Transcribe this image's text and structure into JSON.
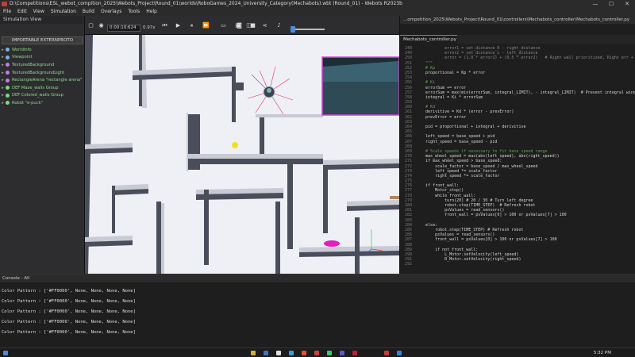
{
  "window": {
    "title": "D:\\Competitions\\ESL_webot_compition_2025\\Webots_Project\\Round_01\\worlds\\RoboGames_2024_University_Category(Mechabots).wbt (Round_01) - Webots R2023b",
    "controls": [
      "—",
      "☐",
      "✕"
    ]
  },
  "menu": [
    "File",
    "Edit",
    "View",
    "Simulation",
    "Build",
    "Overlays",
    "Tools",
    "Help"
  ],
  "scene_tree": {
    "title": "Simulation View",
    "import_button": "IMPORTABLE EXTERNPROTO",
    "items": [
      {
        "label": "WorldInfo",
        "color": "#7fb0e0"
      },
      {
        "label": "Viewpoint",
        "color": "#7fb0e0"
      },
      {
        "label": "TexturedBackground",
        "color": "#c080e0"
      },
      {
        "label": "TexturedBackgroundLight",
        "color": "#c080e0"
      },
      {
        "label": "RectangleArena \"rectangle arena\"",
        "color": "#c080e0"
      },
      {
        "label": "DEF Maze_walls Group",
        "color": "#7fd97f"
      },
      {
        "label": "DEF Colored_walls Group",
        "color": "#7fd97f"
      },
      {
        "label": "Robot \"e-puck\"",
        "color": "#7fd97f"
      }
    ]
  },
  "toolbar": {
    "time": "0:00:10:624",
    "speed": "0.97x"
  },
  "editor": {
    "path": "...ompetition_2025\\Webots_Project\\Round_01\\controllers\\Mechabots_controller\\Mechabots_controller.py",
    "tab": "Mechabots_controller.py",
    "lines": [
      {
        "n": "248",
        "t": "            error1 = set_distance_R - right_distance",
        "c": "#8a8a8a"
      },
      {
        "n": "249",
        "t": "            error2 = set_distance_L - left_distance",
        "c": "#8a8a8a"
      },
      {
        "n": "250",
        "t": "            error = (1.0 * error1) + (0.5 * error2)   # Right wall prioritized, Right err + Left",
        "c": "#8a8a8a"
      },
      {
        "n": "251",
        "t": "    \"\"\"",
        "c": "#8a8a8a"
      },
      {
        "n": "252",
        "t": "    # Kp",
        "c": "#6a9955"
      },
      {
        "n": "253",
        "t": "    proportional = Kp * error",
        "c": "#d4d4d4"
      },
      {
        "n": "254",
        "t": "",
        "c": "#d4d4d4"
      },
      {
        "n": "255",
        "t": "    # Ki",
        "c": "#6a9955"
      },
      {
        "n": "256",
        "t": "    errorSum += error",
        "c": "#d4d4d4"
      },
      {
        "n": "257",
        "t": "    errorSum = max(min(errorSum, integral_LIMIT), - integral_LIMIT)  # Prevent integral wind",
        "c": "#d4d4d4"
      },
      {
        "n": "258",
        "t": "    integral = Ki * errorSum",
        "c": "#d4d4d4"
      },
      {
        "n": "259",
        "t": "",
        "c": "#d4d4d4"
      },
      {
        "n": "260",
        "t": "    # Kd",
        "c": "#6a9955"
      },
      {
        "n": "261",
        "t": "    derivitive = Kd * (error - prevError)",
        "c": "#d4d4d4"
      },
      {
        "n": "262",
        "t": "    prevError = error",
        "c": "#d4d4d4"
      },
      {
        "n": "263",
        "t": "",
        "c": "#d4d4d4"
      },
      {
        "n": "264",
        "t": "    pid = proportional + integral + derivitive",
        "c": "#d4d4d4"
      },
      {
        "n": "265",
        "t": "",
        "c": "#d4d4d4"
      },
      {
        "n": "266",
        "t": "    left_speed = base_speed + pid",
        "c": "#d4d4d4"
      },
      {
        "n": "267",
        "t": "    right_speed = base_speed - pid",
        "c": "#d4d4d4"
      },
      {
        "n": "268",
        "t": "",
        "c": "#d4d4d4"
      },
      {
        "n": "269",
        "t": "    # Scale speeds if necessary to fit base_speed range",
        "c": "#6a9955"
      },
      {
        "n": "270",
        "t": "    max_wheel_speed = max(abs(left_speed), abs(right_speed))",
        "c": "#d4d4d4"
      },
      {
        "n": "271",
        "t": "    if max_wheel_speed > base_speed:",
        "c": "#d4d4d4"
      },
      {
        "n": "272",
        "t": "        scale_factor = base_speed / max_wheel_speed",
        "c": "#d4d4d4"
      },
      {
        "n": "273",
        "t": "        left_speed *= scale_factor",
        "c": "#d4d4d4"
      },
      {
        "n": "274",
        "t": "        right_speed *= scale_factor",
        "c": "#d4d4d4"
      },
      {
        "n": "275",
        "t": "",
        "c": "#d4d4d4"
      },
      {
        "n": "276",
        "t": "    if front_wall:",
        "c": "#d4d4d4"
      },
      {
        "n": "277",
        "t": "        Motor_stop()",
        "c": "#d4d4d4"
      },
      {
        "n": "278",
        "t": "        while front_wall:",
        "c": "#d4d4d4"
      },
      {
        "n": "279",
        "t": "            turn(20) # 20 / 30 # Turn left degree",
        "c": "#d4d4d4"
      },
      {
        "n": "280",
        "t": "            robot.step(TIME_STEP)  # Refresh robot",
        "c": "#d4d4d4"
      },
      {
        "n": "281",
        "t": "            psValues = read_sensors()",
        "c": "#d4d4d4"
      },
      {
        "n": "282",
        "t": "            front_wall = psValues[0] > 100 or psValues[7] > 100",
        "c": "#d4d4d4"
      },
      {
        "n": "283",
        "t": "",
        "c": "#d4d4d4"
      },
      {
        "n": "284",
        "t": "    else:",
        "c": "#d4d4d4"
      },
      {
        "n": "285",
        "t": "        robot.step(TIME_STEP) # Refresh robot",
        "c": "#d4d4d4"
      },
      {
        "n": "286",
        "t": "        psValues = read_sensors()",
        "c": "#d4d4d4"
      },
      {
        "n": "287",
        "t": "        front_wall = psValues[0] > 100 or psValues[7] > 100",
        "c": "#d4d4d4"
      },
      {
        "n": "288",
        "t": "",
        "c": "#d4d4d4"
      },
      {
        "n": "289",
        "t": "        if not front_wall:",
        "c": "#d4d4d4"
      },
      {
        "n": "290",
        "t": "            L_Motor.setVelocity(left_speed)",
        "c": "#d4d4d4"
      },
      {
        "n": "291",
        "t": "            R_Motor.setVelocity(right_speed)",
        "c": "#d4d4d4"
      },
      {
        "n": "292",
        "t": "",
        "c": "#d4d4d4"
      }
    ]
  },
  "console": {
    "title": "Console - All",
    "lines": [
      "Color Pattern : ['#FF0000', None, None, None, None]",
      "Color Pattern : ['#FF0000', None, None, None, None]",
      "Color Pattern : ['#FF0000', None, None, None, None]",
      "Color Pattern : ['#FF0000', None, None, None, None]",
      "Color Pattern : ['#FF0000', None, None, None, None]"
    ]
  },
  "taskbar": {
    "clock": "5:32 PM"
  }
}
